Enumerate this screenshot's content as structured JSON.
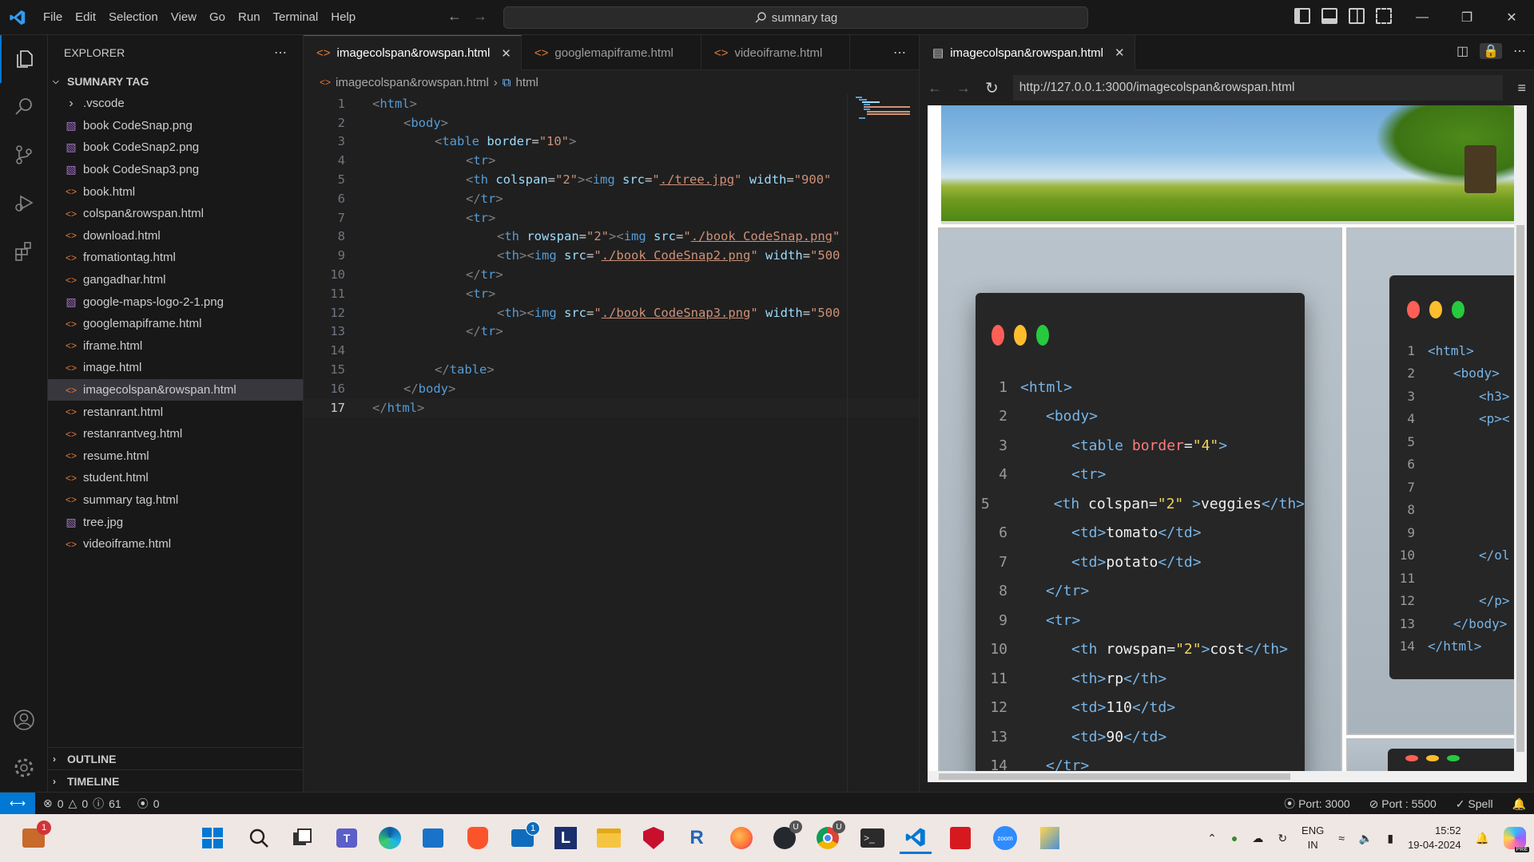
{
  "titlebar": {
    "menu": [
      "File",
      "Edit",
      "Selection",
      "View",
      "Go",
      "Run",
      "Terminal",
      "Help"
    ],
    "search_text": "sumnary tag"
  },
  "sidebar": {
    "header": "EXPLORER",
    "folder_name": "SUMNARY TAG",
    "files": [
      {
        "name": ".vscode",
        "type": "folder"
      },
      {
        "name": "book CodeSnap.png",
        "type": "png"
      },
      {
        "name": "book CodeSnap2.png",
        "type": "png"
      },
      {
        "name": "book CodeSnap3.png",
        "type": "png"
      },
      {
        "name": "book.html",
        "type": "html"
      },
      {
        "name": "colspan&rowspan.html",
        "type": "html"
      },
      {
        "name": "download.html",
        "type": "html"
      },
      {
        "name": "fromationtag.html",
        "type": "html"
      },
      {
        "name": "gangadhar.html",
        "type": "html"
      },
      {
        "name": "google-maps-logo-2-1.png",
        "type": "png"
      },
      {
        "name": "googlemapiframe.html",
        "type": "html"
      },
      {
        "name": "iframe.html",
        "type": "html"
      },
      {
        "name": "image.html",
        "type": "html"
      },
      {
        "name": "imagecolspan&rowspan.html",
        "type": "html",
        "selected": true
      },
      {
        "name": "restanrant.html",
        "type": "html"
      },
      {
        "name": "restanrantveg.html",
        "type": "html"
      },
      {
        "name": "resume.html",
        "type": "html"
      },
      {
        "name": "student.html",
        "type": "html"
      },
      {
        "name": "summary tag.html",
        "type": "html"
      },
      {
        "name": "tree.jpg",
        "type": "png"
      },
      {
        "name": "videoiframe.html",
        "type": "html"
      }
    ],
    "outline_label": "OUTLINE",
    "timeline_label": "TIMELINE"
  },
  "editor": {
    "tabs": [
      {
        "label": "imagecolspan&rowspan.html",
        "active": true
      },
      {
        "label": "googlemapiframe.html",
        "active": false
      },
      {
        "label": "videoiframe.html",
        "active": false
      }
    ],
    "breadcrumb": {
      "file": "imagecolspan&rowspan.html",
      "symbol": "html"
    },
    "current_line": 17,
    "lines": [
      {
        "n": "1",
        "indent": 0,
        "parts": [
          [
            "t-punc",
            "<"
          ],
          [
            "t-tag",
            "html"
          ],
          [
            "t-punc",
            ">"
          ]
        ]
      },
      {
        "n": "2",
        "indent": 1,
        "parts": [
          [
            "t-punc",
            "<"
          ],
          [
            "t-tag",
            "body"
          ],
          [
            "t-punc",
            ">"
          ]
        ]
      },
      {
        "n": "3",
        "indent": 2,
        "parts": [
          [
            "t-punc",
            "<"
          ],
          [
            "t-tag",
            "table "
          ],
          [
            "t-attr",
            "border"
          ],
          [
            "",
            "="
          ],
          [
            "t-str",
            "\"10\""
          ],
          [
            "t-punc",
            ">"
          ]
        ]
      },
      {
        "n": "4",
        "indent": 3,
        "parts": [
          [
            "t-punc",
            "<"
          ],
          [
            "t-tag",
            "tr"
          ],
          [
            "t-punc",
            ">"
          ]
        ]
      },
      {
        "n": "5",
        "indent": 3,
        "parts": [
          [
            "t-punc",
            "<"
          ],
          [
            "t-tag",
            "th "
          ],
          [
            "t-attr",
            "colspan"
          ],
          [
            "",
            "="
          ],
          [
            "t-str",
            "\"2\""
          ],
          [
            "t-punc",
            "><"
          ],
          [
            "t-tag",
            "img "
          ],
          [
            "t-attr",
            "src"
          ],
          [
            "",
            "="
          ],
          [
            "t-str",
            "\""
          ],
          [
            "t-link",
            "./tree.jpg"
          ],
          [
            "t-str",
            "\" "
          ],
          [
            "t-attr",
            "width"
          ],
          [
            "",
            "="
          ],
          [
            "t-str",
            "\"900\""
          ]
        ]
      },
      {
        "n": "6",
        "indent": 3,
        "parts": [
          [
            "t-punc",
            "</"
          ],
          [
            "t-tag",
            "tr"
          ],
          [
            "t-punc",
            ">"
          ]
        ]
      },
      {
        "n": "7",
        "indent": 3,
        "parts": [
          [
            "t-punc",
            "<"
          ],
          [
            "t-tag",
            "tr"
          ],
          [
            "t-punc",
            ">"
          ]
        ]
      },
      {
        "n": "8",
        "indent": 4,
        "parts": [
          [
            "t-punc",
            "<"
          ],
          [
            "t-tag",
            "th "
          ],
          [
            "t-attr",
            "rowspan"
          ],
          [
            "",
            "="
          ],
          [
            "t-str",
            "\"2\""
          ],
          [
            "t-punc",
            "><"
          ],
          [
            "t-tag",
            "img "
          ],
          [
            "t-attr",
            "src"
          ],
          [
            "",
            "="
          ],
          [
            "t-str",
            "\""
          ],
          [
            "t-link",
            "./book CodeSnap.png"
          ],
          [
            "t-str",
            "\""
          ]
        ]
      },
      {
        "n": "9",
        "indent": 4,
        "parts": [
          [
            "t-punc",
            "<"
          ],
          [
            "t-tag",
            "th"
          ],
          [
            "t-punc",
            "><"
          ],
          [
            "t-tag",
            "img "
          ],
          [
            "t-attr",
            "src"
          ],
          [
            "",
            "="
          ],
          [
            "t-str",
            "\""
          ],
          [
            "t-link",
            "./book CodeSnap2.png"
          ],
          [
            "t-str",
            "\" "
          ],
          [
            "t-attr",
            "width"
          ],
          [
            "",
            "="
          ],
          [
            "t-str",
            "\"500"
          ]
        ]
      },
      {
        "n": "10",
        "indent": 3,
        "parts": [
          [
            "t-punc",
            "</"
          ],
          [
            "t-tag",
            "tr"
          ],
          [
            "t-punc",
            ">"
          ]
        ]
      },
      {
        "n": "11",
        "indent": 3,
        "parts": [
          [
            "t-punc",
            "<"
          ],
          [
            "t-tag",
            "tr"
          ],
          [
            "t-punc",
            ">"
          ]
        ]
      },
      {
        "n": "12",
        "indent": 4,
        "parts": [
          [
            "t-punc",
            "<"
          ],
          [
            "t-tag",
            "th"
          ],
          [
            "t-punc",
            "><"
          ],
          [
            "t-tag",
            "img "
          ],
          [
            "t-attr",
            "src"
          ],
          [
            "",
            "="
          ],
          [
            "t-str",
            "\""
          ],
          [
            "t-link",
            "./book CodeSnap3.png"
          ],
          [
            "t-str",
            "\" "
          ],
          [
            "t-attr",
            "width"
          ],
          [
            "",
            "="
          ],
          [
            "t-str",
            "\"500"
          ]
        ]
      },
      {
        "n": "13",
        "indent": 3,
        "parts": [
          [
            "t-punc",
            "</"
          ],
          [
            "t-tag",
            "tr"
          ],
          [
            "t-punc",
            ">"
          ]
        ]
      },
      {
        "n": "14",
        "indent": 0,
        "parts": []
      },
      {
        "n": "15",
        "indent": 2,
        "parts": [
          [
            "t-punc",
            "</"
          ],
          [
            "t-tag",
            "table"
          ],
          [
            "t-punc",
            ">"
          ]
        ]
      },
      {
        "n": "16",
        "indent": 1,
        "parts": [
          [
            "t-punc",
            "</"
          ],
          [
            "t-tag",
            "body"
          ],
          [
            "t-punc",
            ">"
          ]
        ]
      },
      {
        "n": "17",
        "indent": 0,
        "parts": [
          [
            "t-punc",
            "</"
          ],
          [
            "t-tag",
            "html"
          ],
          [
            "t-punc",
            ">"
          ]
        ]
      }
    ]
  },
  "browser": {
    "tab_label": "imagecolspan&rowspan.html",
    "url": "http://127.0.0.1:3000/imagecolspan&rowspan.html",
    "snippet1": {
      "lines": [
        {
          "n": "1",
          "indent": 0,
          "html": "<span class='b'>&lt;html&gt;</span>"
        },
        {
          "n": "2",
          "indent": 1,
          "html": "<span class='b'>&lt;body&gt;</span>"
        },
        {
          "n": "3",
          "indent": 2,
          "html": "<span class='b'>&lt;table</span> <span class='r'>border</span>=<span class='y'>\"4\"</span><span class='b'>&gt;</span>"
        },
        {
          "n": "4",
          "indent": 2,
          "html": "<span class='b'>&lt;tr&gt;</span>"
        },
        {
          "n": "5",
          "indent": 2,
          "html": "<span class='b'>&lt;th</span> <span class='w'>colspan</span>=<span class='y'>\"2\"</span> <span class='b'>&gt;</span><span class='w'>veggies</span><span class='b'>&lt;/th&gt;</span>"
        },
        {
          "n": "6",
          "indent": 2,
          "html": "<span class='b'>&lt;td&gt;</span><span class='w'>tomato</span><span class='b'>&lt;/td&gt;</span>"
        },
        {
          "n": "7",
          "indent": 2,
          "html": "<span class='b'>&lt;td&gt;</span><span class='w'>potato</span><span class='b'>&lt;/td&gt;</span>"
        },
        {
          "n": "8",
          "indent": 1,
          "html": "<span class='b'>&lt;/tr&gt;</span>"
        },
        {
          "n": "9",
          "indent": 1,
          "html": "<span class='b'>&lt;tr&gt;</span>"
        },
        {
          "n": "10",
          "indent": 2,
          "html": "<span class='b'>&lt;th</span> <span class='w'>rowspan</span>=<span class='y'>\"2\"</span><span class='b'>&gt;</span><span class='w'>cost</span><span class='b'>&lt;/th&gt;</span>"
        },
        {
          "n": "11",
          "indent": 2,
          "html": "<span class='b'>&lt;th&gt;</span><span class='w'>rp</span><span class='b'>&lt;/th&gt;</span>"
        },
        {
          "n": "12",
          "indent": 2,
          "html": "<span class='b'>&lt;td&gt;</span><span class='w'>110</span><span class='b'>&lt;/td&gt;</span>"
        },
        {
          "n": "13",
          "indent": 2,
          "html": "<span class='b'>&lt;td&gt;</span><span class='w'>90</span><span class='b'>&lt;/td&gt;</span>"
        },
        {
          "n": "14",
          "indent": 1,
          "html": "<span class='b'>&lt;/tr&gt;</span>"
        }
      ]
    },
    "snippet2": {
      "lines": [
        {
          "n": "1",
          "indent": 0,
          "html": "<span class='b'>&lt;html&gt;</span>"
        },
        {
          "n": "2",
          "indent": 1,
          "html": "<span class='b'>&lt;body&gt;</span>"
        },
        {
          "n": "3",
          "indent": 2,
          "html": "<span class='b'>&lt;h3&gt;</span>"
        },
        {
          "n": "4",
          "indent": 2,
          "html": "<span class='b'>&lt;p&gt;&lt;</span>"
        },
        {
          "n": "5",
          "indent": 0,
          "html": ""
        },
        {
          "n": "6",
          "indent": 0,
          "html": ""
        },
        {
          "n": "7",
          "indent": 0,
          "html": ""
        },
        {
          "n": "8",
          "indent": 0,
          "html": ""
        },
        {
          "n": "9",
          "indent": 0,
          "html": ""
        },
        {
          "n": "10",
          "indent": 2,
          "html": "<span class='b'>&lt;/ol</span>"
        },
        {
          "n": "11",
          "indent": 0,
          "html": ""
        },
        {
          "n": "12",
          "indent": 2,
          "html": "<span class='b'>&lt;/p&gt;</span>"
        },
        {
          "n": "13",
          "indent": 1,
          "html": "<span class='b'>&lt;/body&gt;</span>"
        },
        {
          "n": "14",
          "indent": 0,
          "html": "<span class='b'>&lt;/html&gt;</span>"
        }
      ]
    }
  },
  "statusbar": {
    "errors": "0",
    "warnings": "0",
    "info": "61",
    "ports": "0",
    "port_3000": "Port: 3000",
    "port_5500": "Port : 5500",
    "spell": "Spell"
  },
  "taskbar": {
    "lang_top": "ENG",
    "lang_bottom": "IN",
    "time": "15:52",
    "date": "19-04-2024",
    "badge_left": "1",
    "badge_mail": "1",
    "app_letter_l": "L",
    "app_letter_r": "R",
    "zoom_label": "zoom",
    "badge_u1": "U",
    "badge_u2": "U",
    "pre_label": "PRE"
  }
}
